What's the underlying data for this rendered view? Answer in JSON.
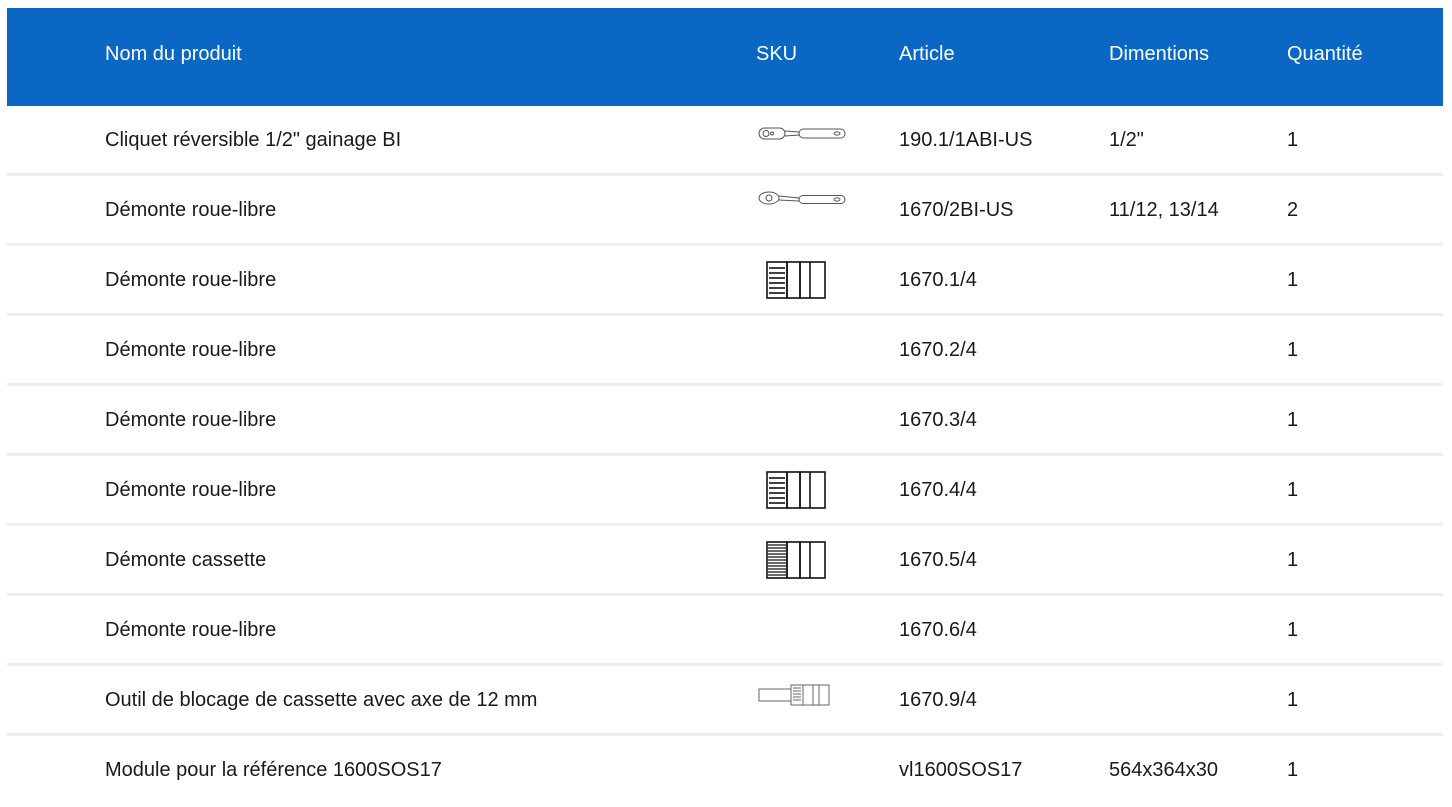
{
  "header": {
    "name": "Nom du produit",
    "sku": "SKU",
    "article": "Article",
    "dimensions": "Dimentions",
    "quantity": "Quantité"
  },
  "rows": [
    {
      "name": "Cliquet réversible 1/2\" gainage BI",
      "sku_icon": "ratchet-icon",
      "article": "190.1/1ABI-US",
      "dimensions": "1/2\"",
      "quantity": "1"
    },
    {
      "name": "Démonte roue-libre",
      "sku_icon": "ratchet-handle-icon",
      "article": "1670/2BI-US",
      "dimensions": "11/12, 13/14",
      "quantity": "2"
    },
    {
      "name": "Démonte roue-libre",
      "sku_icon": "freewheel-socket-icon",
      "article": "1670.1/4",
      "dimensions": "",
      "quantity": "1"
    },
    {
      "name": "Démonte roue-libre",
      "sku_icon": "",
      "article": "1670.2/4",
      "dimensions": "",
      "quantity": "1"
    },
    {
      "name": "Démonte roue-libre",
      "sku_icon": "",
      "article": "1670.3/4",
      "dimensions": "",
      "quantity": "1"
    },
    {
      "name": "Démonte roue-libre",
      "sku_icon": "freewheel-socket-icon",
      "article": "1670.4/4",
      "dimensions": "",
      "quantity": "1"
    },
    {
      "name": "Démonte cassette",
      "sku_icon": "cassette-socket-icon",
      "article": "1670.5/4",
      "dimensions": "",
      "quantity": "1"
    },
    {
      "name": "Démonte roue-libre",
      "sku_icon": "",
      "article": "1670.6/4",
      "dimensions": "",
      "quantity": "1"
    },
    {
      "name": "Outil de blocage de cassette avec axe de 12 mm",
      "sku_icon": "cassette-lock-tool-icon",
      "article": "1670.9/4",
      "dimensions": "",
      "quantity": "1"
    },
    {
      "name": "Module pour la référence 1600SOS17",
      "sku_icon": "",
      "article": "vl1600SOS17",
      "dimensions": "564x364x30",
      "quantity": "1"
    }
  ]
}
